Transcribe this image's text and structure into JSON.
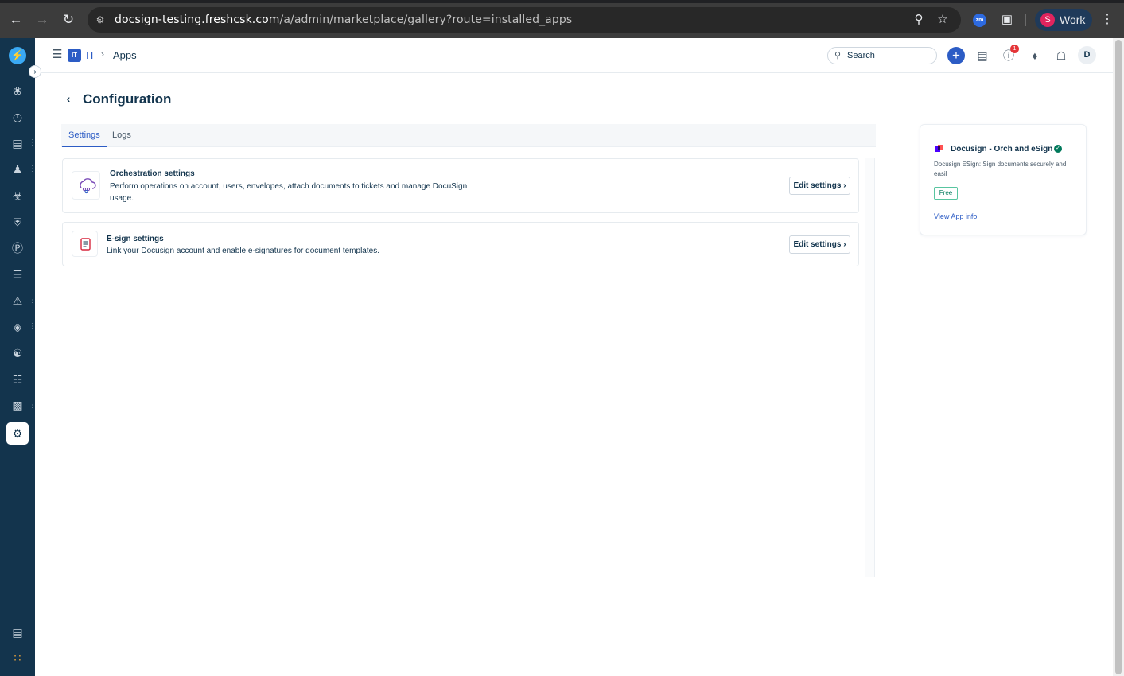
{
  "browser": {
    "url_host": "docsign-testing.freshcsk.com",
    "url_path": "/a/admin/marketplace/gallery?route=installed_apps",
    "extension_label": "zm",
    "profile_initial": "S",
    "profile_label": "Work"
  },
  "nav": {
    "items": [
      "ai-agents",
      "dashboard",
      "tickets",
      "contacts",
      "bugs",
      "shield",
      "billing",
      "tasks",
      "alerts",
      "layers",
      "support",
      "knowledge",
      "reports",
      "admin-settings"
    ],
    "active": "admin-settings"
  },
  "header": {
    "workspace_badge": "IT",
    "workspace_name": "IT",
    "breadcrumb_current": "Apps",
    "search_placeholder": "Search",
    "notification_count": "1",
    "user_initial": "D"
  },
  "page": {
    "title": "Configuration",
    "tabs": [
      {
        "label": "Settings",
        "active": true
      },
      {
        "label": "Logs",
        "active": false
      }
    ]
  },
  "cards": [
    {
      "title": "Orchestration settings",
      "description": "Perform operations on account, users, envelopes, attach documents to tickets and manage DocuSign usage.",
      "button": "Edit settings ›"
    },
    {
      "title": "E-sign settings",
      "description": "Link your Docusign account and enable e-signatures for document templates.",
      "button": "Edit settings ›"
    }
  ],
  "app": {
    "name": "Docusign - Orch and eSign",
    "description": "Docusign ESign: Sign documents securely and easil",
    "price_badge": "Free",
    "view_link": "View App info"
  },
  "colors": {
    "nav_bg": "#13344d",
    "accent": "#2c5cc5",
    "success": "#00795b"
  }
}
